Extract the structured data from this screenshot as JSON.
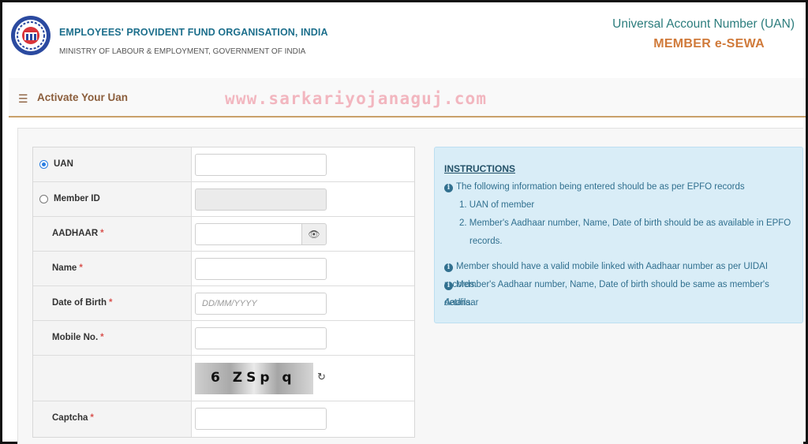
{
  "header": {
    "org_name": "EMPLOYEES' PROVIDENT FUND ORGANISATION, INDIA",
    "ministry": "MINISTRY OF LABOUR & EMPLOYMENT, GOVERNMENT OF INDIA",
    "uan_title": "Universal Account Number (UAN)",
    "service_title": "MEMBER e-SEWA"
  },
  "titlebar": {
    "menu_icon": "hamburger-menu-icon",
    "title": "Activate Your Uan"
  },
  "watermark": "www.sarkariyojanaguj.com",
  "form": {
    "uan": {
      "label": "UAN",
      "selected": true,
      "value": ""
    },
    "member_id": {
      "label": "Member ID",
      "selected": false,
      "value": ""
    },
    "aadhaar": {
      "label": "AADHAAR",
      "required": "*",
      "value": "",
      "toggle_icon": "eye-slash-icon"
    },
    "name": {
      "label": "Name",
      "required": "*",
      "value": ""
    },
    "dob": {
      "label": "Date of Birth",
      "required": "*",
      "placeholder": "DD/MM/YYYY"
    },
    "mobile": {
      "label": "Mobile No.",
      "required": "*",
      "value": ""
    },
    "captcha_image_text": "6 ZSp q",
    "captcha_refresh_icon": "refresh-icon",
    "captcha": {
      "label": "Captcha",
      "required": "*",
      "value": ""
    }
  },
  "instructions": {
    "title": "INSTRUCTIONS",
    "info_icon": "info-circle-icon",
    "line1": "The following information being entered should be as per EPFO records",
    "sub1": "1. UAN of member",
    "sub2a": "2. Member's Aadhaar number, Name, Date of birth should be as available in EPFO",
    "sub2b": "records.",
    "line2": "Member should have a valid mobile linked with Aadhaar number as per UIDAI records.",
    "line3a": "Member's Aadhaar number, Name, Date of birth should be same as member's Aadhaar",
    "line3b": "details."
  },
  "colors": {
    "org_teal": "#1d6f8c",
    "esewa_orange": "#d07a3a",
    "title_brown": "#8b5e3c",
    "info_bg": "#d9edf7",
    "info_text": "#31708f",
    "required_red": "#d9534f"
  }
}
